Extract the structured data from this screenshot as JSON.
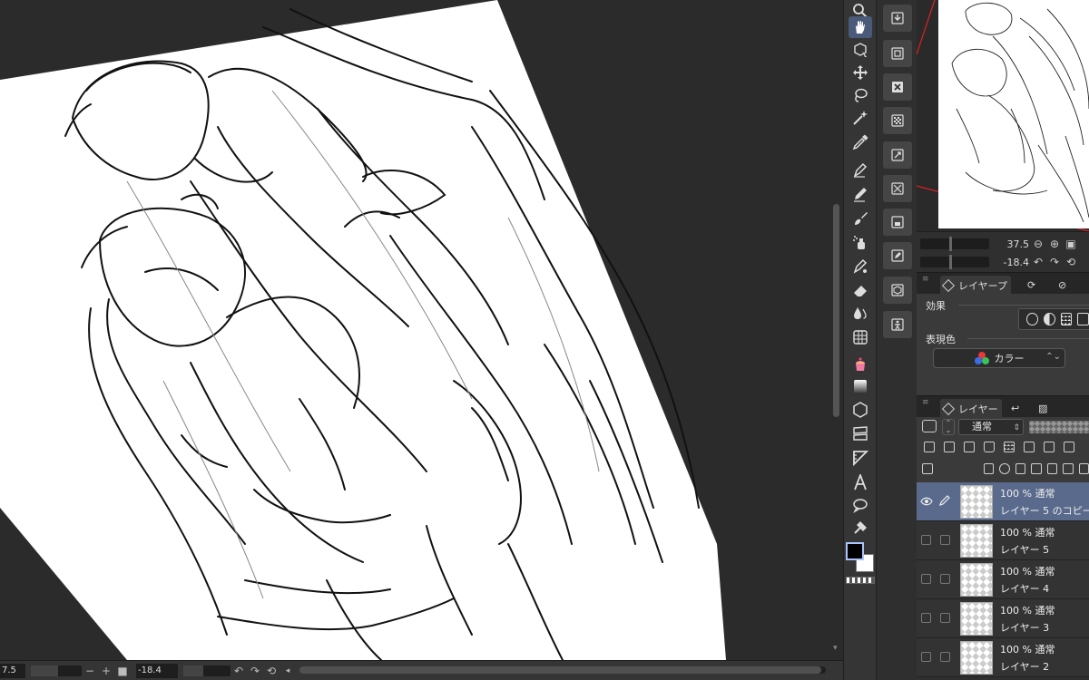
{
  "canvas": {
    "rotation_readout": "-18.4",
    "zoom_readout": "7.5"
  },
  "navigator": {
    "zoom_value": "37.5",
    "rotation_value": "-18.4"
  },
  "properties_panel": {
    "tab_label": "レイヤープ",
    "effect_label": "効果",
    "expression_color_label": "表現色",
    "expression_color_value": "カラー"
  },
  "layer_panel": {
    "tab_label": "レイヤー",
    "blend_mode": "通常",
    "layers": [
      {
        "mode": "100 % 通常",
        "name": "レイヤー 5 のコピー",
        "selected": true,
        "visible": true
      },
      {
        "mode": "100 % 通常",
        "name": "レイヤー 5",
        "selected": false,
        "visible": false
      },
      {
        "mode": "100 % 通常",
        "name": "レイヤー 4",
        "selected": false,
        "visible": false
      },
      {
        "mode": "100 % 通常",
        "name": "レイヤー 3",
        "selected": false,
        "visible": false
      },
      {
        "mode": "100 % 通常",
        "name": "レイヤー 2",
        "selected": false,
        "visible": false
      }
    ]
  },
  "tools": [
    "zoom-icon",
    "hand-icon",
    "object-select-icon",
    "move-icon",
    "lasso-icon",
    "magic-wand-icon",
    "eyedropper-icon",
    "pen-icon",
    "pencil-icon",
    "brush-icon",
    "airbrush-icon",
    "decoration-icon",
    "eraser-icon",
    "blend-icon",
    "perspective-grid-icon",
    "fill-icon",
    "gradient-icon",
    "figure-icon",
    "frame-icon",
    "ruler-icon",
    "text-icon",
    "balloon-icon",
    "correction-icon"
  ],
  "colors": {
    "main_color": "#000000",
    "sub_color": "#ffffff",
    "accent": "#4a5a78",
    "selected_layer": "#5a6a8c"
  }
}
